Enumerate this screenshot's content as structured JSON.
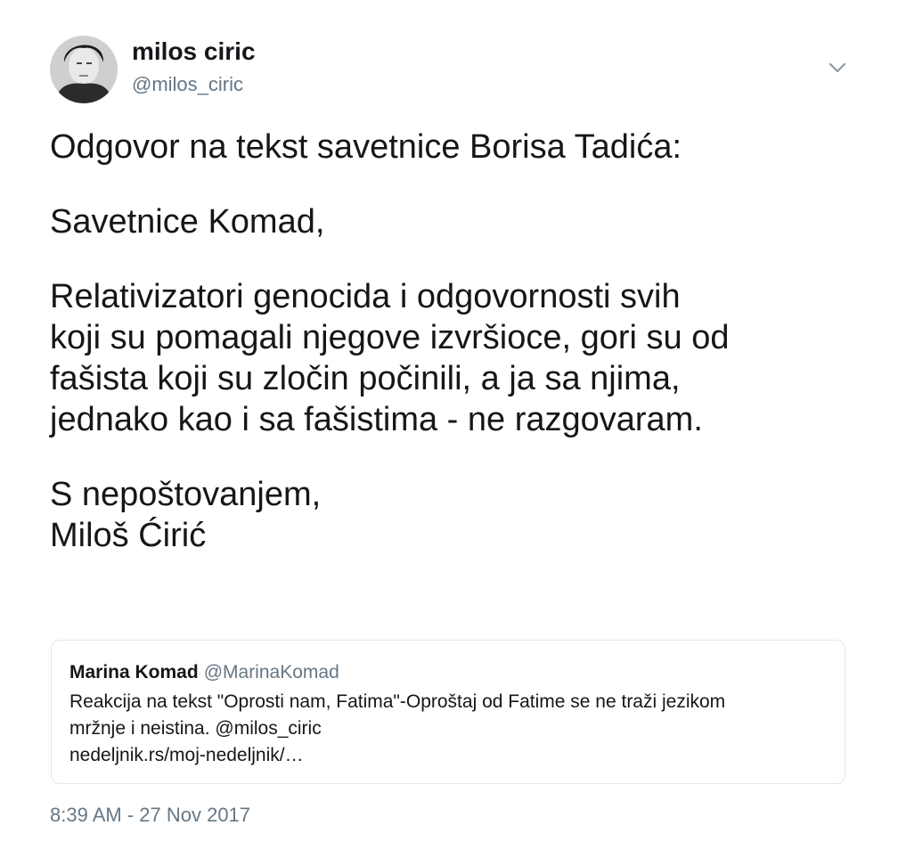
{
  "author": {
    "name": "milos ciric",
    "handle": "@milos_ciric",
    "avatar_icon": "profile-photo-avatar"
  },
  "tweet": {
    "lines": [
      "Odgovor na tekst savetnice Borisa Tadića:",
      "Savetnice Komad,",
      "Relativizatori genocida i odgovornosti svih",
      "koji su pomagali njegove izvršioce, gori su od",
      "fašista koji su zločin počinili, a ja sa njima,",
      "jednako kao i sa fašistima - ne razgovaram.",
      "S nepoštovanjem,",
      "Miloš Ćirić"
    ]
  },
  "quoted_tweet": {
    "name": "Marina Komad",
    "handle": "@MarinaKomad",
    "lines": [
      "Reakcija na tekst \"Oprosti nam, Fatima\"-Oproštaj od Fatime se ne traži jezikom",
      "mržnje i neistina. @milos_ciric",
      "nedeljnik.rs/moj-nedeljnik/…"
    ]
  },
  "timestamp": "8:39 AM - 27 Nov 2017",
  "icons": {
    "caret": "chevron-down-icon"
  },
  "colors": {
    "text_primary": "#14171a",
    "text_secondary": "#657786",
    "border": "#e1e8ed",
    "background": "#ffffff"
  }
}
